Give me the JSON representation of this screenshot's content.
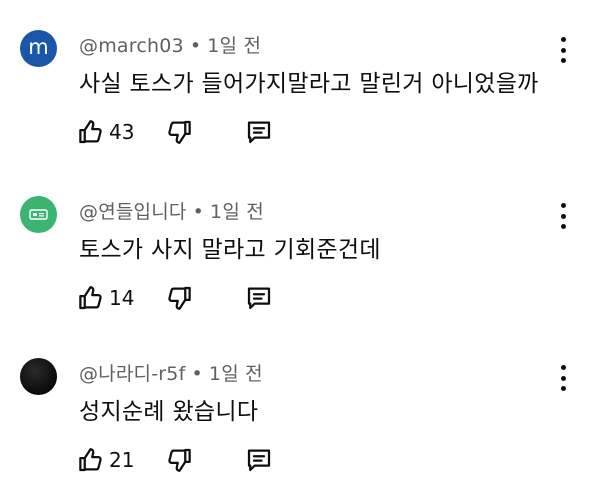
{
  "comments": [
    {
      "avatar_letter": "m",
      "author": "@march03",
      "separator": "•",
      "time": "1일 전",
      "text": "사실 토스가 들어가지말라고 말린거 아니었을까",
      "likes": "43"
    },
    {
      "avatar_letter": "",
      "author": "@연들입니다",
      "separator": "•",
      "time": "1일 전",
      "text": "토스가 사지 말라고 기회준건데",
      "likes": "14"
    },
    {
      "avatar_letter": "",
      "author": "@나라디-r5f",
      "separator": "•",
      "time": "1일 전",
      "text": "성지순례 왔습니다",
      "likes": "21"
    }
  ],
  "icons": {
    "like": "thumbs-up-icon",
    "dislike": "thumbs-down-icon",
    "reply": "reply-comment-icon",
    "more": "more-vertical-icon"
  },
  "colors": {
    "avatar_blue": "#1a57a8",
    "avatar_green": "#3bb371",
    "meta_gray": "#606060",
    "text": "#0f0f0f"
  }
}
